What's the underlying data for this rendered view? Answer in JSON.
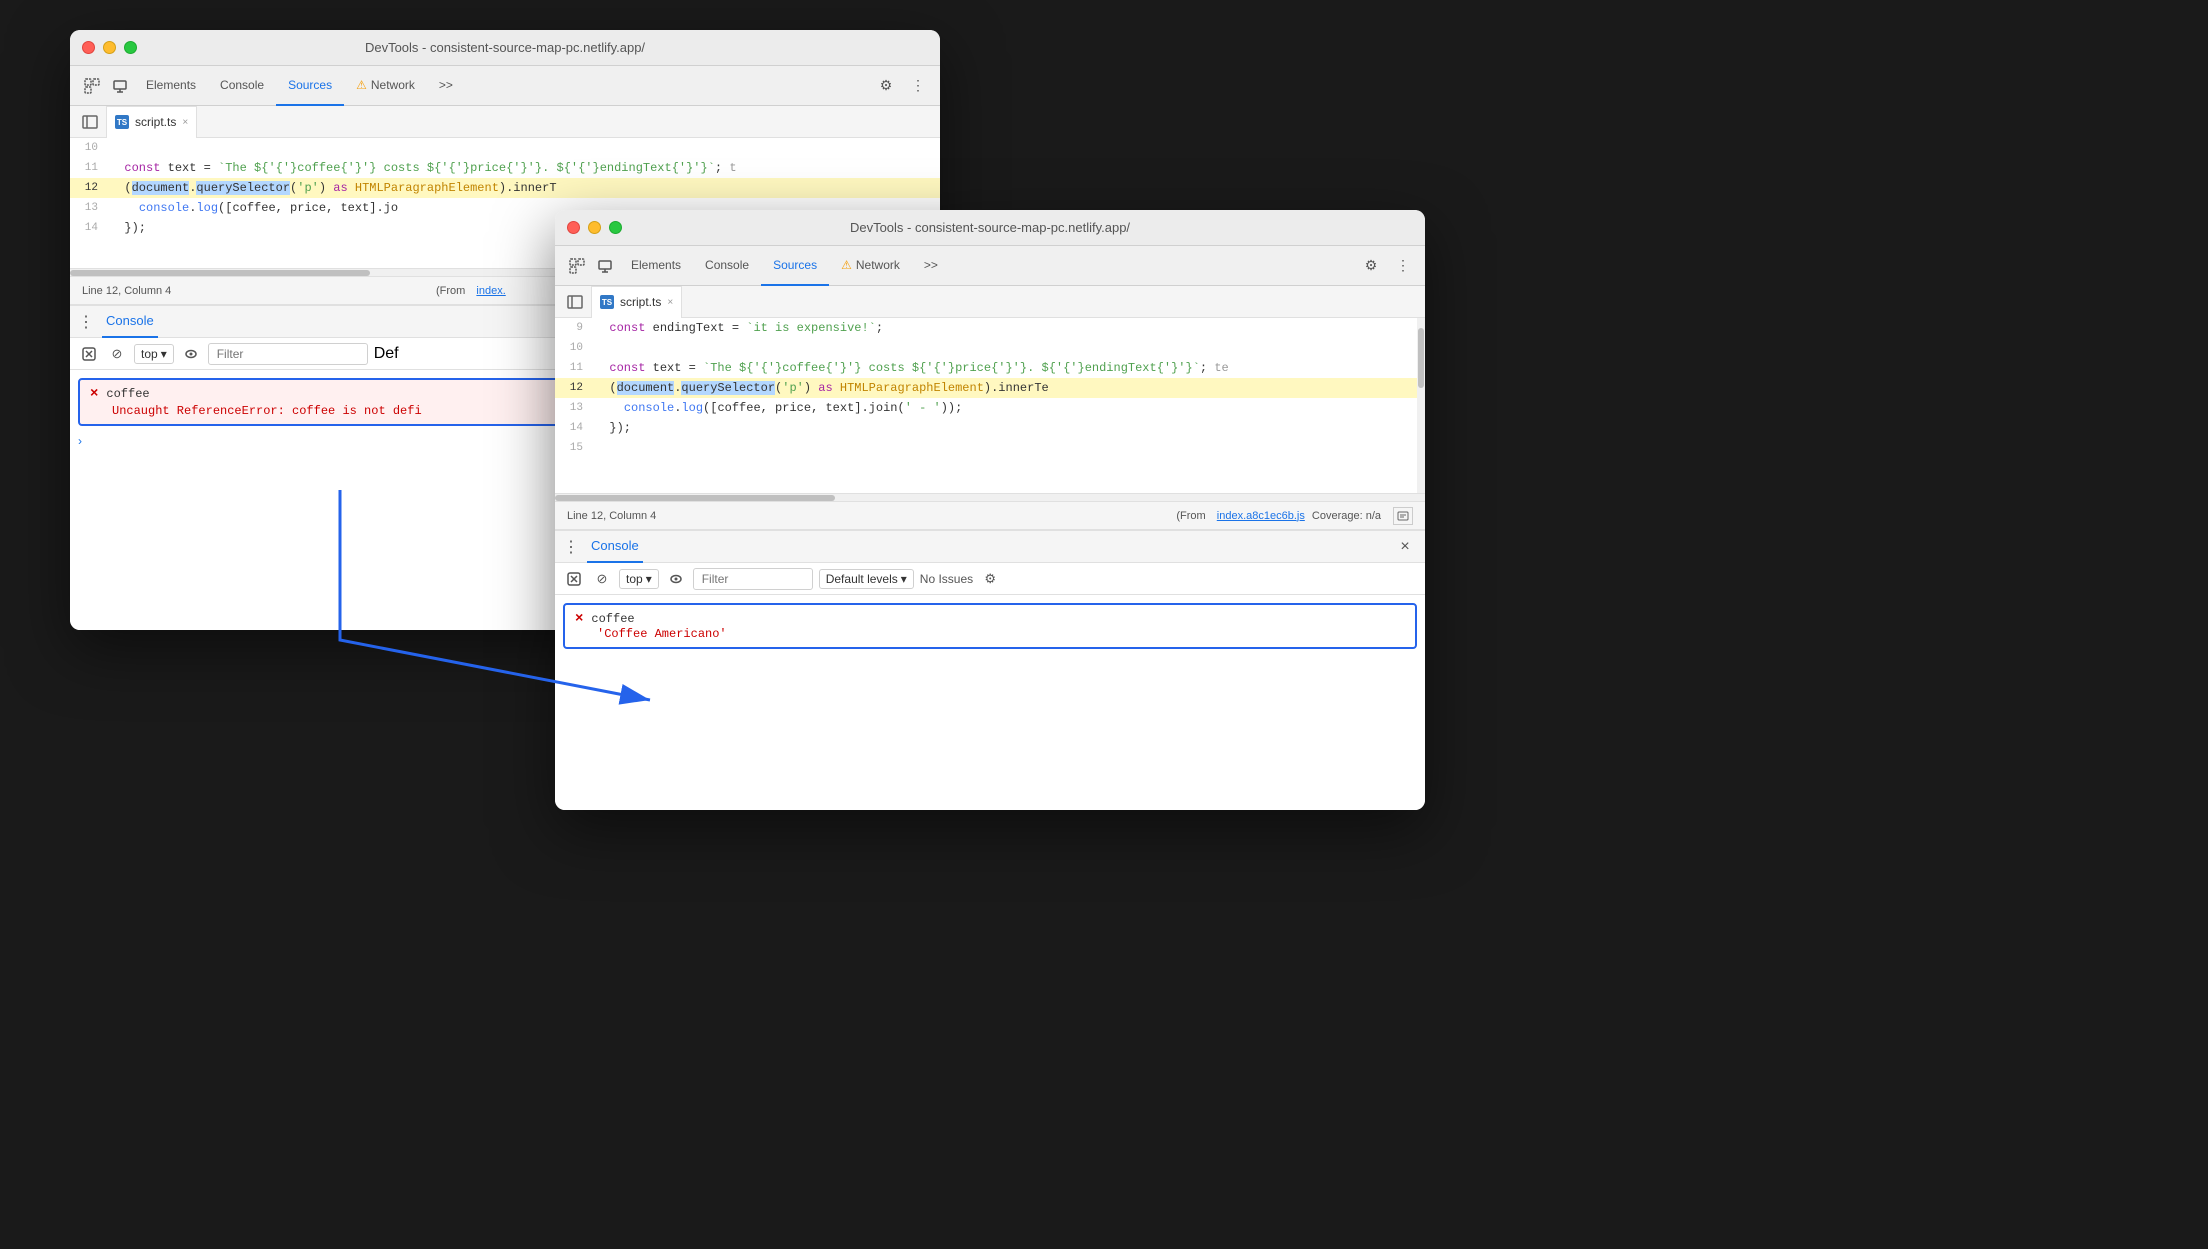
{
  "window1": {
    "title": "DevTools - consistent-source-map-pc.netlify.app/",
    "tabs": {
      "elements": "Elements",
      "console": "Console",
      "sources": "Sources",
      "network": "Network",
      "more": ">>"
    },
    "active_tab": "Sources",
    "file_tab": "script.ts",
    "code_lines": [
      {
        "num": "10",
        "content": ""
      },
      {
        "num": "11",
        "content": "  const text = `The ${coffee} costs ${price}. ${endingText}`;  t"
      },
      {
        "num": "12",
        "content": "  (document.querySelector('p') as HTMLParagraphElement).innerT",
        "highlighted": true
      },
      {
        "num": "13",
        "content": "    console.log([coffee, price, text].jo"
      },
      {
        "num": "14",
        "content": "  });"
      }
    ],
    "status": {
      "line": "Line 12, Column 4",
      "from_text": "(From",
      "from_link": "index.",
      "coverage": ""
    },
    "console": {
      "title": "Console",
      "toolbar": {
        "top_label": "top",
        "filter_placeholder": "Filter",
        "default_levels": "Def"
      },
      "error": {
        "name": "coffee",
        "message": "Uncaught ReferenceError: coffee is not defi"
      }
    }
  },
  "window2": {
    "title": "DevTools - consistent-source-map-pc.netlify.app/",
    "tabs": {
      "elements": "Elements",
      "console": "Console",
      "sources": "Sources",
      "network": "Network",
      "more": ">>"
    },
    "active_tab": "Sources",
    "file_tab": "script.ts",
    "code_lines": [
      {
        "num": "9",
        "content": "  const endingText = `it is expensive!`;"
      },
      {
        "num": "10",
        "content": ""
      },
      {
        "num": "11",
        "content": "  const text = `The ${coffee} costs ${price}. ${endingText}`;  te"
      },
      {
        "num": "12",
        "content": "  (document.querySelector('p') as HTMLParagraphElement).innerTe",
        "highlighted": true
      },
      {
        "num": "13",
        "content": "    console.log([coffee, price, text].join(' - '));"
      },
      {
        "num": "14",
        "content": "  });"
      },
      {
        "num": "15",
        "content": ""
      }
    ],
    "status": {
      "line": "Line 12, Column 4",
      "from_text": "(From",
      "from_link": "index.a8c1ec6b.js",
      "coverage_label": "Coverage: n/a"
    },
    "console": {
      "title": "Console",
      "toolbar": {
        "top_label": "top",
        "filter_placeholder": "Filter",
        "default_levels": "Default levels",
        "no_issues": "No Issues"
      },
      "entry": {
        "name": "coffee",
        "value": "'Coffee Americano'"
      }
    }
  },
  "arrow": {
    "label": "connecting arrow"
  },
  "icons": {
    "inspect": "⬚",
    "device": "⬜",
    "settings": "⚙",
    "more_vert": "⋮",
    "sidebar": "⊞",
    "close": "×",
    "clear": "⊘",
    "eye": "👁",
    "chevron_down": "▾",
    "caret_right": "›",
    "ts": "TS"
  }
}
